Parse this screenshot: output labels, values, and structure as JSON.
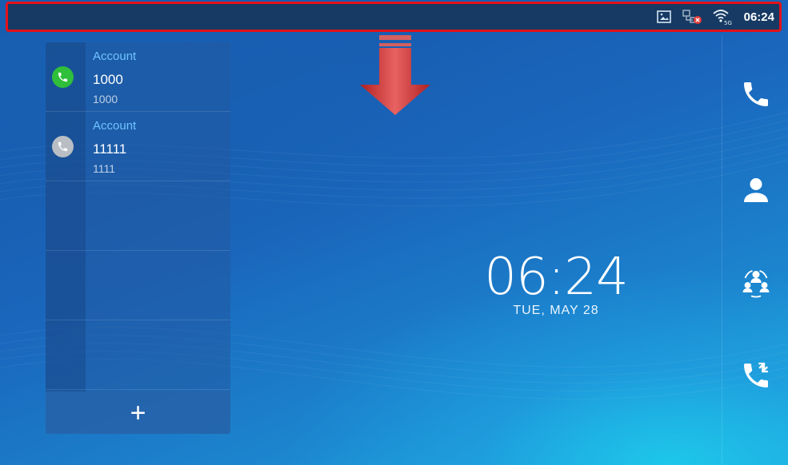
{
  "status_bar": {
    "time": "06:24",
    "icons": [
      "screenshot-icon",
      "network-disconnected-icon",
      "wifi-5g-icon"
    ],
    "highlight_color": "#e3111a"
  },
  "accounts": [
    {
      "title": "Account",
      "name": "1000",
      "number": "1000",
      "status": "registered",
      "status_color": "#2fbf3a"
    },
    {
      "title": "Account",
      "name": "11111",
      "number": "1111",
      "status": "unregistered",
      "status_color": "#b9bec4"
    }
  ],
  "add_button": "+",
  "clock": {
    "time": "06:24",
    "date": "TUE, MAY 28"
  },
  "right_rail": [
    "phone-icon",
    "contacts-icon",
    "conference-icon",
    "call-history-icon"
  ]
}
